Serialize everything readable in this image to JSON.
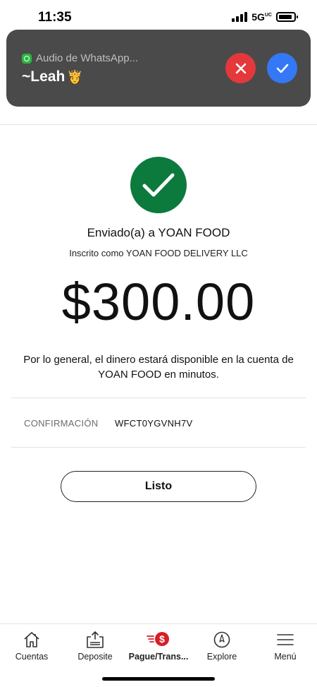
{
  "status_bar": {
    "time": "11:35",
    "network": "5G",
    "network_superscript": "UC"
  },
  "notification": {
    "app_label": "Audio de WhatsApp...",
    "title": "~Leah",
    "emoji": "👸",
    "decline_icon": "close-icon",
    "accept_icon": "checkmark-icon",
    "decline_color": "#e5383b",
    "accept_color": "#3478f6"
  },
  "confirmation_screen": {
    "success_icon": "checkmark-circle-icon",
    "success_color": "#0c7a3d",
    "sent_to": "Enviado(a) a YOAN FOOD",
    "registered_as": "Inscrito como YOAN FOOD DELIVERY LLC",
    "amount": "$300.00",
    "info_text": "Por lo general, el dinero estará disponible en la cuenta de YOAN FOOD en minutos.",
    "confirmation_label": "CONFIRMACIÓN",
    "confirmation_value": "WFCT0YGVNH7V",
    "done_button": "Listo"
  },
  "tab_bar": {
    "active_color": "#d71e28",
    "tabs": [
      {
        "label": "Cuentas",
        "icon": "home-icon",
        "active": false
      },
      {
        "label": "Deposite",
        "icon": "deposit-upload-icon",
        "active": false
      },
      {
        "label": "Pague/Trans...",
        "icon": "pay-transfer-dollar-icon",
        "active": true
      },
      {
        "label": "Explore",
        "icon": "compass-icon",
        "active": false
      },
      {
        "label": "Menú",
        "icon": "hamburger-menu-icon",
        "active": false
      }
    ]
  }
}
